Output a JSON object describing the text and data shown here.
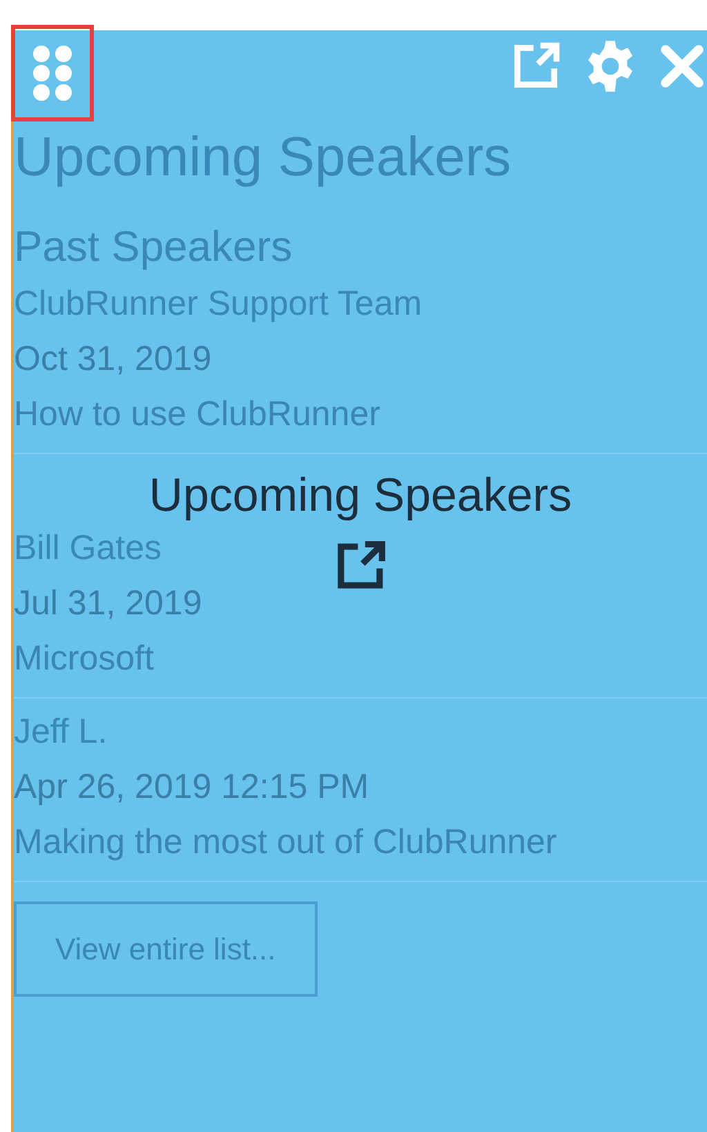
{
  "widget": {
    "title": "Upcoming Speakers",
    "drag_handle": {
      "highlighted": true
    }
  },
  "section_title": "Past Speakers",
  "speakers": [
    {
      "name": "ClubRunner Support Team",
      "date": "Oct 31, 2019",
      "topic": "How to use ClubRunner"
    },
    {
      "name": "Bill Gates",
      "date": "Jul 31, 2019",
      "topic": "Microsoft"
    },
    {
      "name": "Jeff L.",
      "date": "Apr 26, 2019 12:15 PM",
      "topic": "Making the most out of ClubRunner"
    }
  ],
  "view_all_button": "View entire list...",
  "overlay": {
    "label": "Upcoming Speakers"
  }
}
